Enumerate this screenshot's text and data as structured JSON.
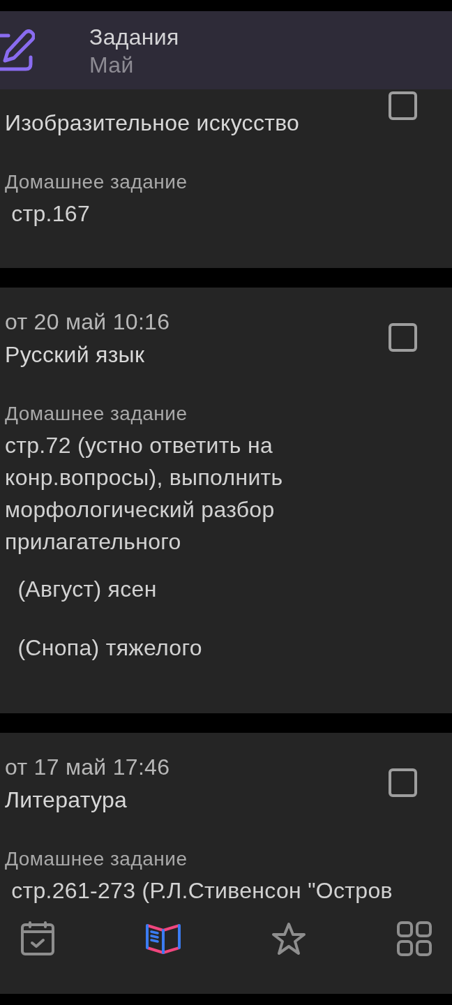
{
  "header": {
    "title": "Задания",
    "subtitle": "Май"
  },
  "assignments": [
    {
      "subject": "Изобразительное искусство",
      "checked": false,
      "homework_label": "Домашнее задание",
      "homework": [
        " стр.167"
      ]
    },
    {
      "date": "от 20 май 10:16",
      "subject": "Русский язык",
      "checked": false,
      "homework_label": "Домашнее задание",
      "homework": [
        "стр.72 (устно ответить на конр.вопросы), выполнить морфологический разбор прилагательного",
        "  (Август) ясен",
        "  (Снопа) тяжелого"
      ]
    },
    {
      "date": "от 17 май 17:46",
      "subject": "Литература",
      "checked": false,
      "homework_label": "Домашнее задание",
      "homework": [
        " стр.261-273 (Р.Л.Стивенсон \"Остров"
      ]
    }
  ],
  "bottom_nav": [
    {
      "selected": false
    },
    {
      "selected": true
    },
    {
      "selected": false
    },
    {
      "selected": false
    }
  ]
}
